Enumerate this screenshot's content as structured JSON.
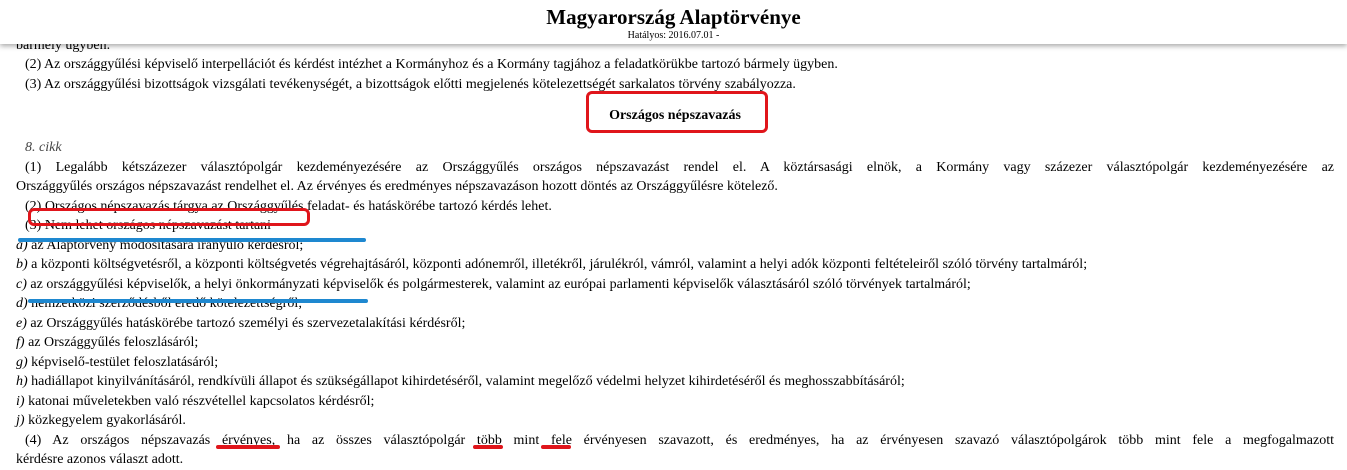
{
  "header": {
    "title": "Magyarország Alaptörvénye",
    "subtitle": "Hatályos: 2016.07.01 -"
  },
  "cut_line": "bármely ügyben.",
  "para_2": "(2) Az országgyűlési képviselő interpellációt és kérdést intézhet a Kormányhoz és a Kormány tagjához a feladatkörükbe tartozó bármely ügyben.",
  "para_3": "(3) Az országgyűlési bizottságok vizsgálati tevékenységét, a bizottságok előtti megjelenés kötelezettségét sarkalatos törvény szabályozza.",
  "section_heading": "Országos népszavazás",
  "article": "8. cikk",
  "art_p1_line1": "(1) Legalább kétszázezer választópolgár kezdeményezésére az Országgyűlés országos népszavazást rendel el. A köztársasági elnök, a Kormány vagy százezer választópolgár kezdeményezésére az",
  "art_p1_line2": "Országgyűlés országos népszavazást rendelhet el. Az érvényes és eredményes népszavazáson hozott döntés az Országgyűlésre kötelező.",
  "art_p2": "(2) Országos népszavazás tárgya az Országgyűlés feladat- és hatáskörébe tartozó kérdés lehet.",
  "art_p3": "(3) Nem lehet országos népszavazást tartani",
  "items": [
    {
      "letter": "a)",
      "text": " az Alaptörvény módosítására irányuló kérdésről;"
    },
    {
      "letter": "b)",
      "text": " a központi költségvetésről, a központi költségvetés végrehajtásáról, központi adónemről, illetékről, járulékról, vámról, valamint a helyi adók központi feltételeiről szóló törvény tartalmáról;"
    },
    {
      "letter": "c)",
      "text": " az országgyűlési képviselők, a helyi önkormányzati képviselők és polgármesterek, valamint az európai parlamenti képviselők választásáról szóló törvények tartalmáról;"
    },
    {
      "letter": "d)",
      "text": " nemzetközi szerződésből eredő kötelezettségről;"
    },
    {
      "letter": "e)",
      "text": " az Országgyűlés hatáskörébe tartozó személyi és szervezetalakítási kérdésről;"
    },
    {
      "letter": "f)",
      "text": " az Országgyűlés feloszlásáról;"
    },
    {
      "letter": "g)",
      "text": " képviselő-testület feloszlatásáról;"
    },
    {
      "letter": "h)",
      "text": " hadiállapot kinyilvánításáról, rendkívüli állapot és szükségállapot kihirdetéséről, valamint megelőző védelmi helyzet kihirdetéséről és meghosszabbításáról;"
    },
    {
      "letter": "i)",
      "text": " katonai műveletekben való részvétellel kapcsolatos kérdésről;"
    },
    {
      "letter": "j)",
      "text": " közkegyelem gyakorlásáról."
    }
  ],
  "art_p4_line1": "(4) Az országos népszavazás érvényes, ha az összes választópolgár több mint fele érvényesen szavazott, és eredményes, ha az érvényesen szavazó választópolgárok több mint fele a megfogalmazott",
  "art_p4_line2": "kérdésre azonos választ adott.",
  "colors": {
    "annotation_red": "#e0151b",
    "annotation_blue": "#1e88d0"
  }
}
